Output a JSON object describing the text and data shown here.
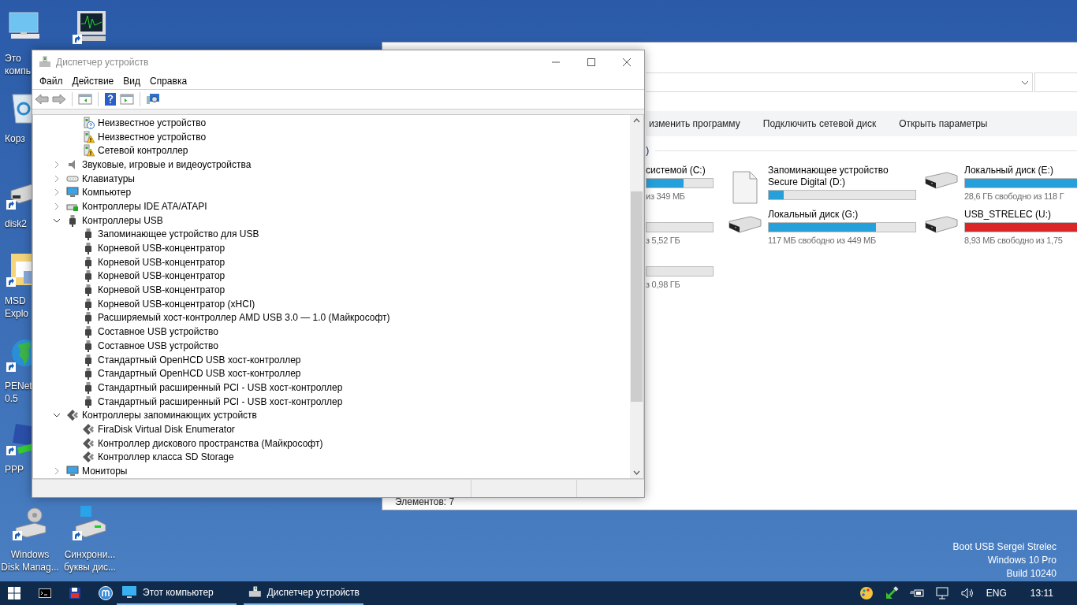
{
  "desktop_icons": [
    {
      "kind": "computer",
      "label": [
        "Это",
        "компь"
      ]
    },
    {
      "kind": "monitor-chart"
    },
    {
      "kind": "recycle",
      "label": [
        "Корз"
      ]
    },
    {
      "kind": "disk",
      "label": [
        "disk2"
      ]
    },
    {
      "kind": "folder",
      "label": [
        "MSD",
        "Explo"
      ]
    },
    {
      "kind": "globe",
      "label": [
        "PENet",
        "0.5"
      ]
    },
    {
      "kind": "network",
      "label": [
        "PPP"
      ]
    },
    {
      "kind": "diskmgmt",
      "label": [
        "Windows",
        "Disk Manag..."
      ]
    },
    {
      "kind": "sync",
      "label": [
        "Синхрони...",
        "буквы дис..."
      ]
    }
  ],
  "desktop_info": [
    "Boot USB Sergei Strelec",
    "Windows 10 Pro",
    "Build 10240"
  ],
  "explorer": {
    "ribbon": [
      "изменить программу",
      "Подключить сетевой диск",
      "Открыть параметры"
    ],
    "group_header": ")",
    "drives": [
      {
        "kind": "partial",
        "name": "системой (C:)",
        "level": 0.56,
        "color": "#26a0da",
        "free": "из 349 МБ"
      },
      {
        "kind": "removable",
        "name": "Запоминающее устройство Secure Digital (D:)",
        "level": 0.1,
        "color": "#26a0da"
      },
      {
        "kind": "disk",
        "name": "Локальный диск (E:)",
        "level": 0.8,
        "color": "#26a0da",
        "free": "28,6 ГБ свободно из 118 Г"
      },
      {
        "kind": "partial",
        "free": "з 5,52 ГБ"
      },
      {
        "kind": "disk",
        "name": "Локальный диск (G:)",
        "level": 0.73,
        "color": "#26a0da",
        "free": "117 МБ свободно из 449 МБ"
      },
      {
        "kind": "disk",
        "name": "USB_STRELEC (U:)",
        "level": 0.99,
        "color": "#da2626",
        "free": "8,93 МБ свободно из 1,75"
      },
      {
        "kind": "partial",
        "free": "з 0,98 ГБ"
      }
    ],
    "status": "Элементов: 7"
  },
  "device_manager": {
    "title": "Диспетчер устройств",
    "menu": [
      "Файл",
      "Действие",
      "Вид",
      "Справка"
    ],
    "tree": [
      {
        "children": [
          {
            "kind": "question-device",
            "label": "Неизвестное устройство"
          },
          {
            "kind": "warning-device",
            "label": "Неизвестное устройство"
          },
          {
            "kind": "warning-device",
            "label": "Сетевой контроллер"
          }
        ]
      },
      {
        "kind": "sound",
        "label": "Звуковые, игровые и видеоустройства",
        "expanded": false
      },
      {
        "kind": "keyboard",
        "label": "Клавиатуры",
        "expanded": false
      },
      {
        "kind": "computer",
        "label": "Компьютер",
        "expanded": false
      },
      {
        "kind": "ide",
        "label": "Контроллеры IDE ATA/ATAPI",
        "expanded": false
      },
      {
        "kind": "usb",
        "label": "Контроллеры USB",
        "expanded": true,
        "children": [
          {
            "kind": "usb",
            "label": "Запоминающее устройство для USB"
          },
          {
            "kind": "usb",
            "label": "Корневой USB-концентратор"
          },
          {
            "kind": "usb",
            "label": "Корневой USB-концентратор"
          },
          {
            "kind": "usb",
            "label": "Корневой USB-концентратор"
          },
          {
            "kind": "usb",
            "label": "Корневой USB-концентратор"
          },
          {
            "kind": "usb",
            "label": "Корневой USB-концентратор (xHCI)"
          },
          {
            "kind": "usb",
            "label": "Расширяемый хост-контроллер AMD USB 3.0 — 1.0 (Майкрософт)"
          },
          {
            "kind": "usb",
            "label": "Составное USB устройство"
          },
          {
            "kind": "usb",
            "label": "Составное USB устройство"
          },
          {
            "kind": "usb",
            "label": "Стандартный OpenHCD USB хост-контроллер"
          },
          {
            "kind": "usb",
            "label": "Стандартный OpenHCD USB хост-контроллер"
          },
          {
            "kind": "usb",
            "label": "Стандартный расширенный PCI - USB хост-контроллер"
          },
          {
            "kind": "usb",
            "label": "Стандартный расширенный PCI - USB хост-контроллер"
          }
        ]
      },
      {
        "kind": "storage",
        "label": "Контроллеры запоминающих устройств",
        "expanded": true,
        "children": [
          {
            "kind": "storage",
            "label": "FiraDisk Virtual Disk Enumerator"
          },
          {
            "kind": "storage",
            "label": "Контроллер дискового пространства (Майкрософт)"
          },
          {
            "kind": "storage",
            "label": "Контроллер класса SD Storage"
          }
        ]
      },
      {
        "kind": "monitor",
        "label": "Мониторы",
        "expanded": false
      }
    ]
  },
  "taskbar": {
    "tasks": [
      "Этот компьютер",
      "Диспетчер устройств"
    ],
    "language": "ENG",
    "time": "13:11"
  }
}
